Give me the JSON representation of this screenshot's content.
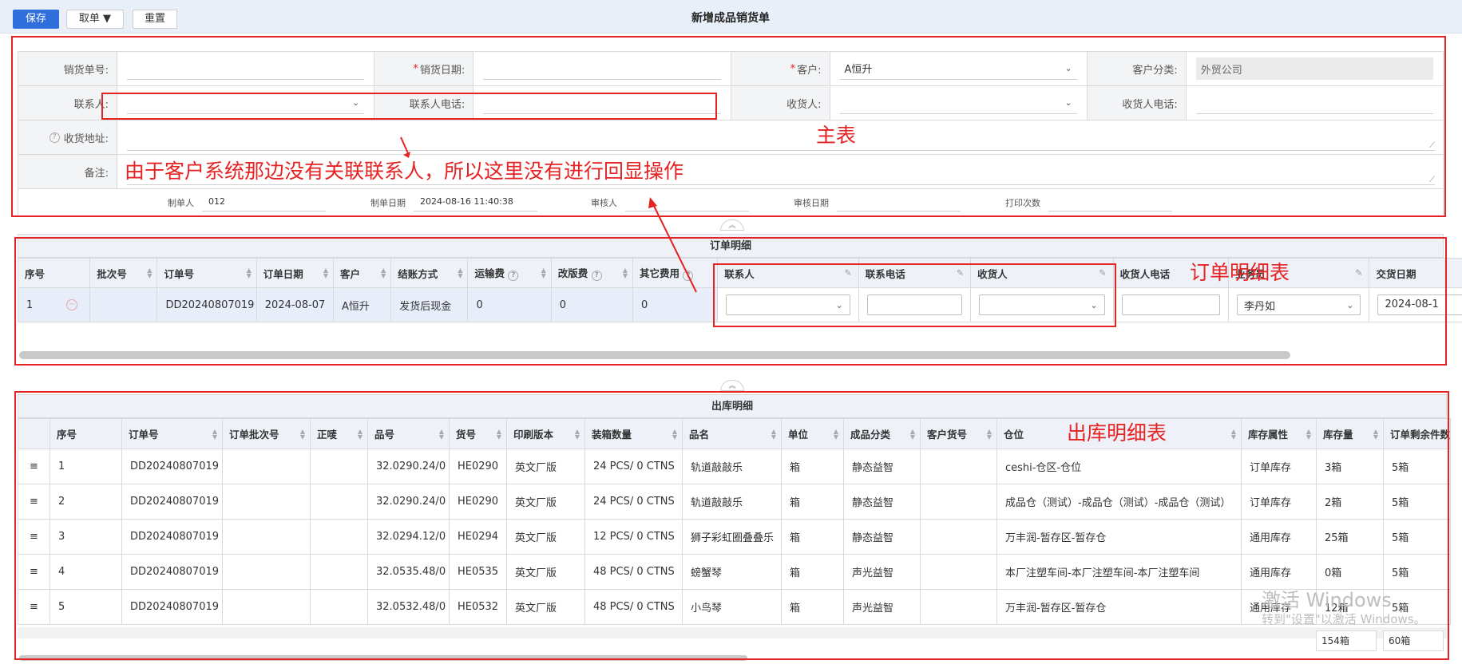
{
  "toolbar": {
    "save": "保存",
    "fetch_order": "取单 ▼",
    "reset": "重置",
    "title": "新增成品销货单"
  },
  "master": {
    "sales_no_label": "销货单号:",
    "sales_no": "",
    "sales_date_label": "销货日期:",
    "sales_date": "",
    "customer_label": "客户:",
    "customer": "A恒升",
    "customer_type_label": "客户分类:",
    "customer_type": "外贸公司",
    "contact_label": "联系人:",
    "contact": "",
    "contact_phone_label": "联系人电话:",
    "contact_phone": "",
    "receiver_label": "收货人:",
    "receiver": "",
    "receiver_phone_label": "收货人电话:",
    "receiver_phone": "",
    "address_label": "收货地址:",
    "remark_label": "备注:",
    "maker_label": "制单人",
    "maker": "012",
    "make_date_label": "制单日期",
    "make_date": "2024-08-16 11:40:38",
    "auditor_label": "审核人",
    "audit_date_label": "审核日期",
    "print_count_label": "打印次数"
  },
  "annotations": {
    "master": "主表",
    "note": "由于客户系统那边没有关联联系人，所以这里没有进行回显操作",
    "order_detail": "订单明细表",
    "outbound_detail": "出库明细表"
  },
  "order_detail": {
    "title": "订单明细",
    "headers": [
      "序号",
      "批次号",
      "订单号",
      "订单日期",
      "客户",
      "结账方式",
      "运输费",
      "改版费",
      "其它费用",
      "联系人",
      "联系电话",
      "收货人",
      "收货人电话",
      "业务员",
      "交货日期"
    ],
    "row": {
      "seq": "1",
      "batch": "",
      "order_no": "DD20240807019",
      "order_date": "2024-08-07",
      "customer": "A恒升",
      "settlement": "发货后现金",
      "freight": "0",
      "revision_fee": "0",
      "other_fee": "0",
      "contact": "",
      "contact_phone": "",
      "receiver": "",
      "receiver_phone": "",
      "salesman": "李丹如",
      "delivery_date": "2024-08-1"
    }
  },
  "outbound_detail": {
    "title": "出库明细",
    "headers": [
      "序号",
      "订单号",
      "订单批次号",
      "正唛",
      "品号",
      "货号",
      "印刷版本",
      "装箱数量",
      "品名",
      "单位",
      "成品分类",
      "客户货号",
      "仓位",
      "库存属性",
      "库存量",
      "订单剩余件数"
    ],
    "rows": [
      [
        "1",
        "DD20240807019",
        "",
        "",
        "32.0290.24/0",
        "HE0290",
        "英文厂版",
        "24 PCS/ 0 CTNS",
        "轨道敲敲乐",
        "箱",
        "静态益智",
        "",
        "ceshi-仓区-仓位",
        "订单库存",
        "3箱",
        "5箱"
      ],
      [
        "2",
        "DD20240807019",
        "",
        "",
        "32.0290.24/0",
        "HE0290",
        "英文厂版",
        "24 PCS/ 0 CTNS",
        "轨道敲敲乐",
        "箱",
        "静态益智",
        "",
        "成品仓（测试）-成品仓（测试）-成品仓（测试）",
        "订单库存",
        "2箱",
        "5箱"
      ],
      [
        "3",
        "DD20240807019",
        "",
        "",
        "32.0294.12/0",
        "HE0294",
        "英文厂版",
        "12 PCS/ 0 CTNS",
        "狮子彩虹圈叠叠乐",
        "箱",
        "静态益智",
        "",
        "万丰润-暂存区-暂存仓",
        "通用库存",
        "25箱",
        "5箱"
      ],
      [
        "4",
        "DD20240807019",
        "",
        "",
        "32.0535.48/0",
        "HE0535",
        "英文厂版",
        "48 PCS/ 0 CTNS",
        "螃蟹琴",
        "箱",
        "声光益智",
        "",
        "本厂注塑车间-本厂注塑车间-本厂注塑车间",
        "通用库存",
        "0箱",
        "5箱"
      ],
      [
        "5",
        "DD20240807019",
        "",
        "",
        "32.0532.48/0",
        "HE0532",
        "英文厂版",
        "48 PCS/ 0 CTNS",
        "小鸟琴",
        "箱",
        "声光益智",
        "",
        "万丰润-暂存区-暂存仓",
        "通用库存",
        "12箱",
        "5箱"
      ]
    ],
    "sum_stock": "154箱",
    "sum_remaining": "60箱"
  },
  "watermark": {
    "line1": "激活 Windows",
    "line2": "转到\"设置\"以激活 Windows。"
  },
  "colors": {
    "primary": "#2f6fdb",
    "annotation_red": "#e52323",
    "header_bg": "#eef2f8"
  }
}
